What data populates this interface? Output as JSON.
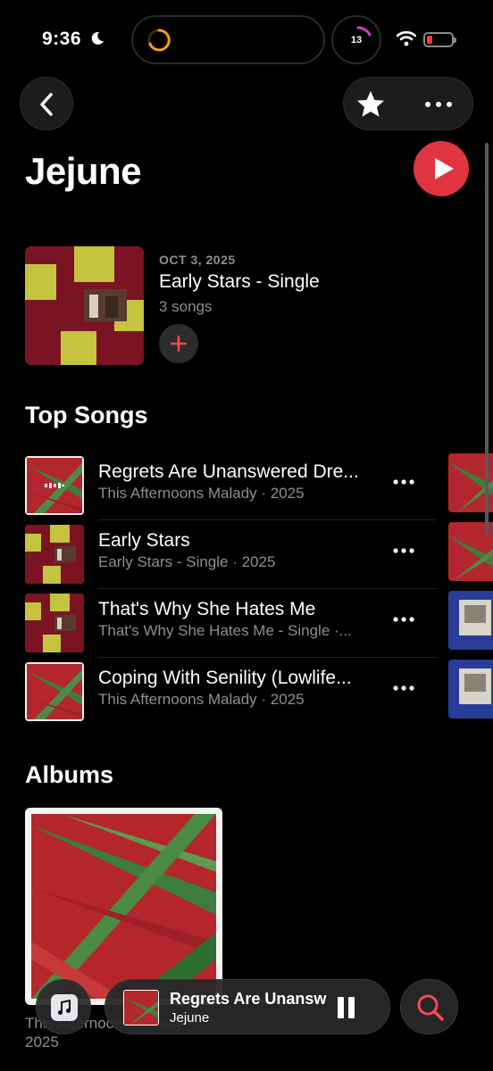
{
  "status": {
    "time": "9:36",
    "notification_count": "13"
  },
  "artist": {
    "name": "Jejune"
  },
  "latest_release": {
    "date": "OCT 3, 2025",
    "title": "Early Stars - Single",
    "count": "3 songs"
  },
  "sections": {
    "top_songs": "Top Songs",
    "albums": "Albums"
  },
  "songs": [
    {
      "title": "Regrets Are Unanswered Dre...",
      "subtitle": "This Afternoons Malady · 2025",
      "art": "leaf",
      "playing": true
    },
    {
      "title": "Early Stars",
      "subtitle": "Early Stars - Single · 2025",
      "art": "yellow"
    },
    {
      "title": "That's Why She Hates Me",
      "subtitle": "That's Why She Hates Me - Single ·...",
      "art": "yellow"
    },
    {
      "title": "Coping With Senility (Lowlife...",
      "subtitle": "This Afternoons Malady · 2025",
      "art": "leaf"
    }
  ],
  "albums": [
    {
      "title": "This Afternoons Malady",
      "year": "2025"
    }
  ],
  "now_playing": {
    "title": "Regrets Are Unansw",
    "artist": "Jejune"
  },
  "colors": {
    "accent": "#e0343f",
    "background": "#000000",
    "secondary_text": "#8e8e93"
  },
  "icons": [
    "back-chevron-icon",
    "star-icon",
    "more-icon",
    "play-icon",
    "plus-icon",
    "music-note-icon",
    "pause-icon",
    "search-icon"
  ]
}
